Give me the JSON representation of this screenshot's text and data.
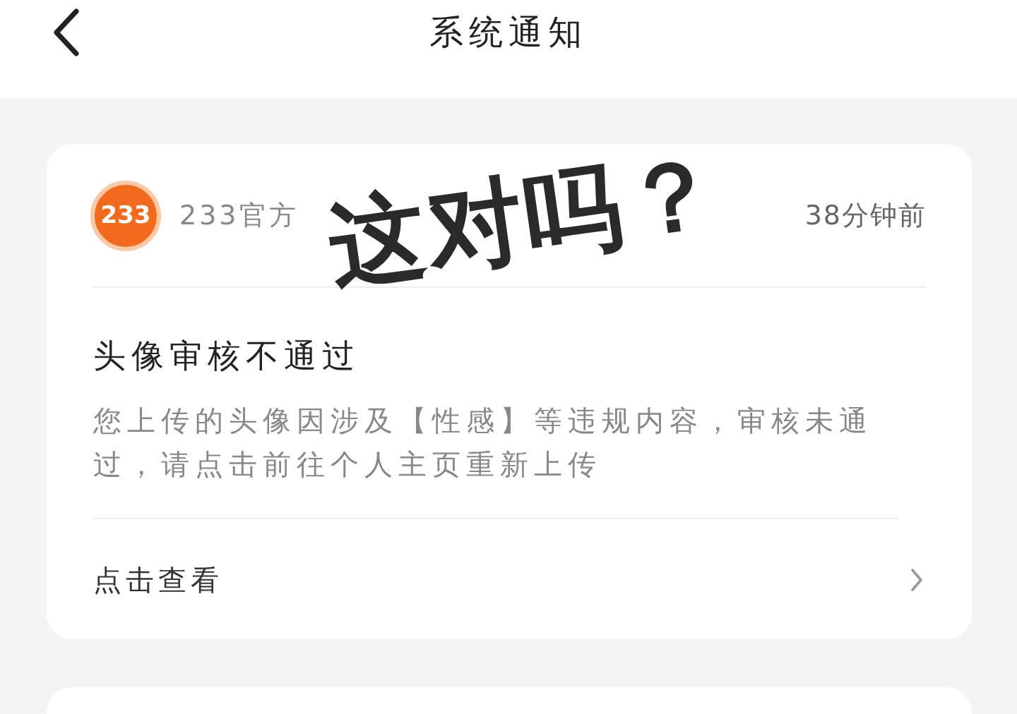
{
  "header": {
    "title": "系统通知"
  },
  "notification": {
    "avatar_text": "233",
    "sender": "233官方",
    "time": "38分钟前",
    "title": "头像审核不通过",
    "body": "您上传的头像因涉及【性感】等违规内容，审核未通过，请点击前往个人主页重新上传",
    "action": "点击查看"
  },
  "annotation": {
    "text": "这对吗？"
  }
}
